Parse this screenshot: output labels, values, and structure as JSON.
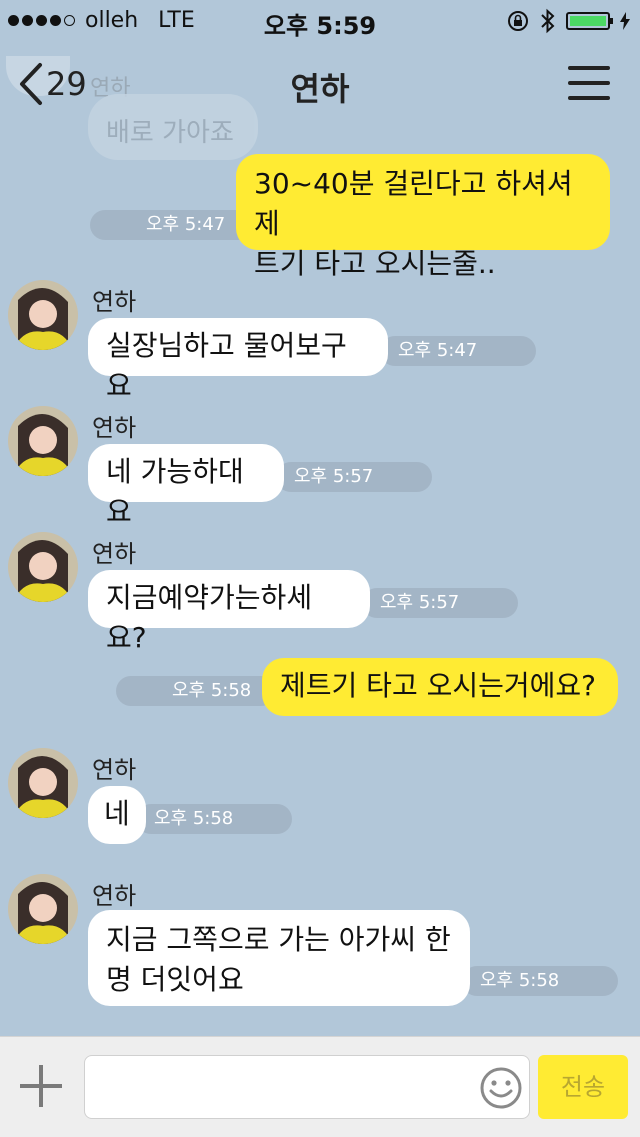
{
  "status_bar": {
    "carrier": "olleh",
    "network": "LTE",
    "time": "오후 5:59"
  },
  "nav": {
    "unread_count": "29",
    "title": "연하"
  },
  "background_ghost": {
    "text": "배로 가아죠"
  },
  "messages": [
    {
      "from": "me",
      "lines": [
        "30~40분 걸린다고 하셔셔 제",
        "트기 타고 오시는줄.."
      ],
      "time": "오후 5:47"
    },
    {
      "from": "other",
      "name": "연하",
      "lines": [
        "실장님하고 물어보구요"
      ],
      "time": "오후 5:47"
    },
    {
      "from": "other",
      "name": "연하",
      "lines": [
        "네 가능하대요"
      ],
      "time": "오후 5:57"
    },
    {
      "from": "other",
      "name": "연하",
      "lines": [
        "지금예약가는하세요?"
      ],
      "time": "오후 5:57"
    },
    {
      "from": "me",
      "lines": [
        "제트기 타고 오시는거에요?"
      ],
      "time": "오후 5:58"
    },
    {
      "from": "other",
      "name": "연하",
      "lines": [
        "네"
      ],
      "time": "오후 5:58"
    },
    {
      "from": "other",
      "name": "연하",
      "lines": [
        "지금 그쪽으로 가는 아가씨 한",
        "명 더잇어요"
      ],
      "time": "오후 5:58"
    }
  ],
  "composer": {
    "send_label": "전송",
    "placeholder": ""
  },
  "colors": {
    "background": "#b2c7d9",
    "my_bubble": "#ffeb33",
    "their_bubble": "#ffffff",
    "timestamp_pill": "#a3b5c6"
  }
}
